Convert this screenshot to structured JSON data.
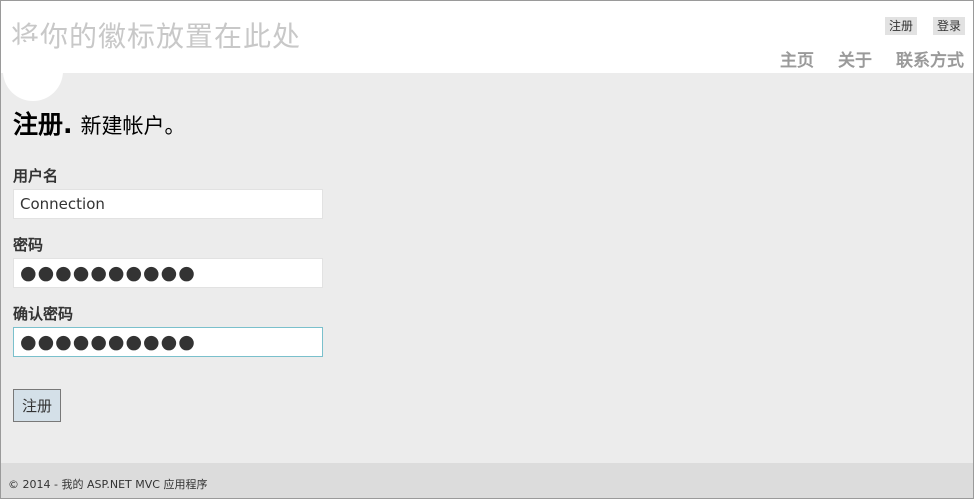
{
  "header": {
    "logo_text": "将你的徽标放置在此处",
    "auth_links": {
      "register": "注册",
      "login": "登录"
    },
    "nav": [
      {
        "label": "主页"
      },
      {
        "label": "关于"
      },
      {
        "label": "联系方式"
      }
    ]
  },
  "form": {
    "title": "注册.",
    "subtitle": "新建帐户。",
    "username_label": "用户名",
    "username_value": "Connection",
    "password_label": "密码",
    "password_mask": "●●●●●●●●●●",
    "confirm_label": "确认密码",
    "confirm_mask": "●●●●●●●●●●",
    "submit_label": "注册"
  },
  "footer": {
    "text": "© 2014 - 我的 ASP.NET MVC 应用程序"
  }
}
